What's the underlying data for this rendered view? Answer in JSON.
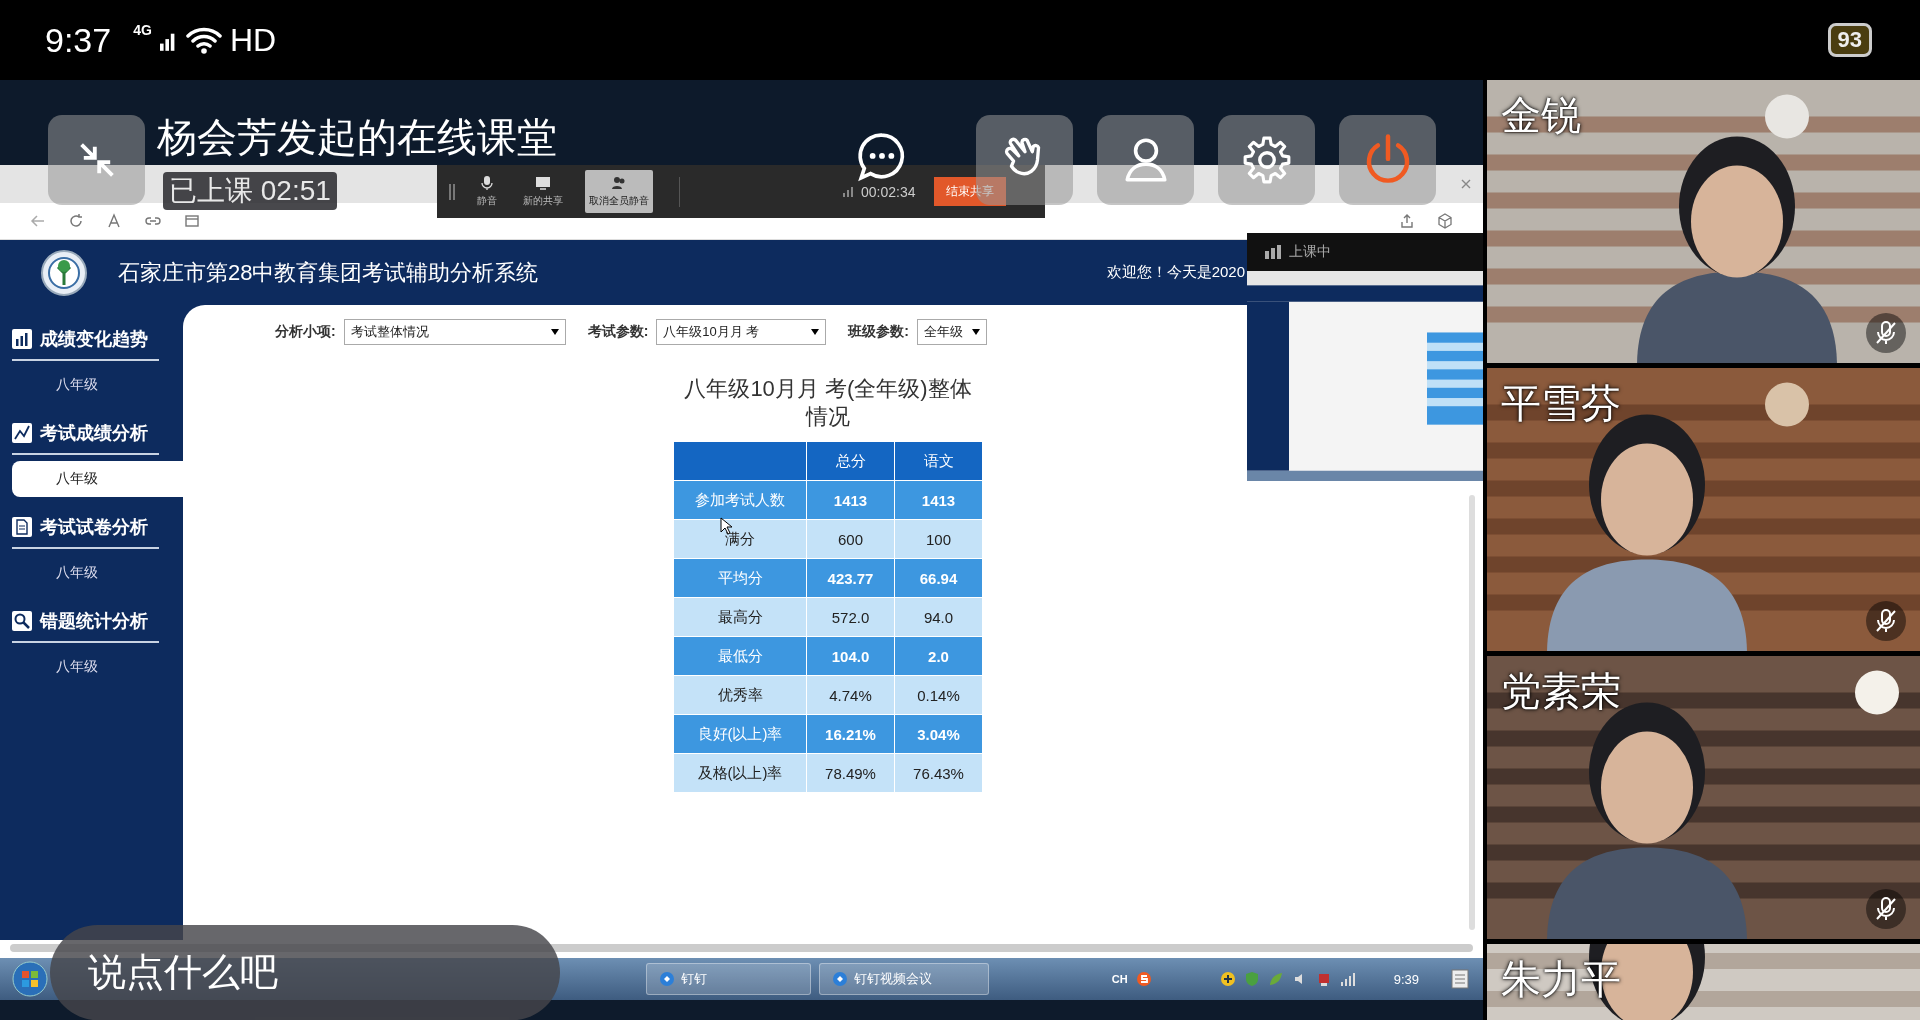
{
  "status_bar": {
    "time": "9:37",
    "network": "4G",
    "quality": "HD",
    "battery": "93"
  },
  "meeting": {
    "title": "杨会芳发起的在线课堂",
    "elapsed": "已上课 02:51"
  },
  "share_toolbar": {
    "buttons": [
      {
        "label": "静音",
        "kind": "mic",
        "selected": false
      },
      {
        "label": "新的共享",
        "kind": "screen",
        "selected": false
      },
      {
        "label": "取消全员静音",
        "kind": "people",
        "selected": true
      }
    ],
    "timer": "00:02:34",
    "end_button": "结束共享"
  },
  "app": {
    "title": "石家庄市第28中教育集团考试辅助分析系统",
    "welcome": "欢迎您！今天是2020",
    "sidebar": [
      {
        "label": "成绩变化趋势",
        "kind": "chart",
        "children": [
          {
            "label": "八年级",
            "selected": false
          }
        ]
      },
      {
        "label": "考试成绩分析",
        "kind": "trend",
        "children": [
          {
            "label": "八年级",
            "selected": true
          }
        ]
      },
      {
        "label": "考试试卷分析",
        "kind": "document",
        "children": [
          {
            "label": "八年级",
            "selected": false
          }
        ]
      },
      {
        "label": "错题统计分析",
        "kind": "search",
        "children": [
          {
            "label": "八年级",
            "selected": false
          }
        ]
      }
    ],
    "filters": [
      {
        "label": "分析小项:",
        "value": "考试整体情况"
      },
      {
        "label": "考试参数:",
        "value": "八年级10月月 考"
      },
      {
        "label": "班级参数:",
        "value": "全年级"
      }
    ],
    "report_title": "八年级10月月 考(全年级)整体情况",
    "table": {
      "columns": [
        "",
        "总分",
        "语文"
      ],
      "rows": [
        {
          "cells": [
            "参加考试人数",
            "1413",
            "1413"
          ],
          "emphasized": true
        },
        {
          "cells": [
            "满分",
            "600",
            "100"
          ],
          "emphasized": false
        },
        {
          "cells": [
            "平均分",
            "423.77",
            "66.94"
          ],
          "emphasized": true
        },
        {
          "cells": [
            "最高分",
            "572.0",
            "94.0"
          ],
          "emphasized": false
        },
        {
          "cells": [
            "最低分",
            "104.0",
            "2.0"
          ],
          "emphasized": true
        },
        {
          "cells": [
            "优秀率",
            "4.74%",
            "0.14%"
          ],
          "emphasized": false
        },
        {
          "cells": [
            "良好(以上)率",
            "16.21%",
            "3.04%"
          ],
          "emphasized": true
        },
        {
          "cells": [
            "及格(以上)率",
            "78.49%",
            "76.43%"
          ],
          "emphasized": false
        }
      ]
    }
  },
  "preview": {
    "status": "上课中"
  },
  "taskbar": {
    "items": [
      {
        "label": "钉钉"
      },
      {
        "label": "钉钉视频会议"
      }
    ],
    "input_method": "CH",
    "time": "9:39"
  },
  "comment_field": {
    "placeholder": "说点什么吧"
  },
  "participants": [
    {
      "name": "金锐",
      "muted": true
    },
    {
      "name": "平雪芬",
      "muted": true
    },
    {
      "name": "党素荣",
      "muted": true
    },
    {
      "name": "朱力平"
    }
  ]
}
